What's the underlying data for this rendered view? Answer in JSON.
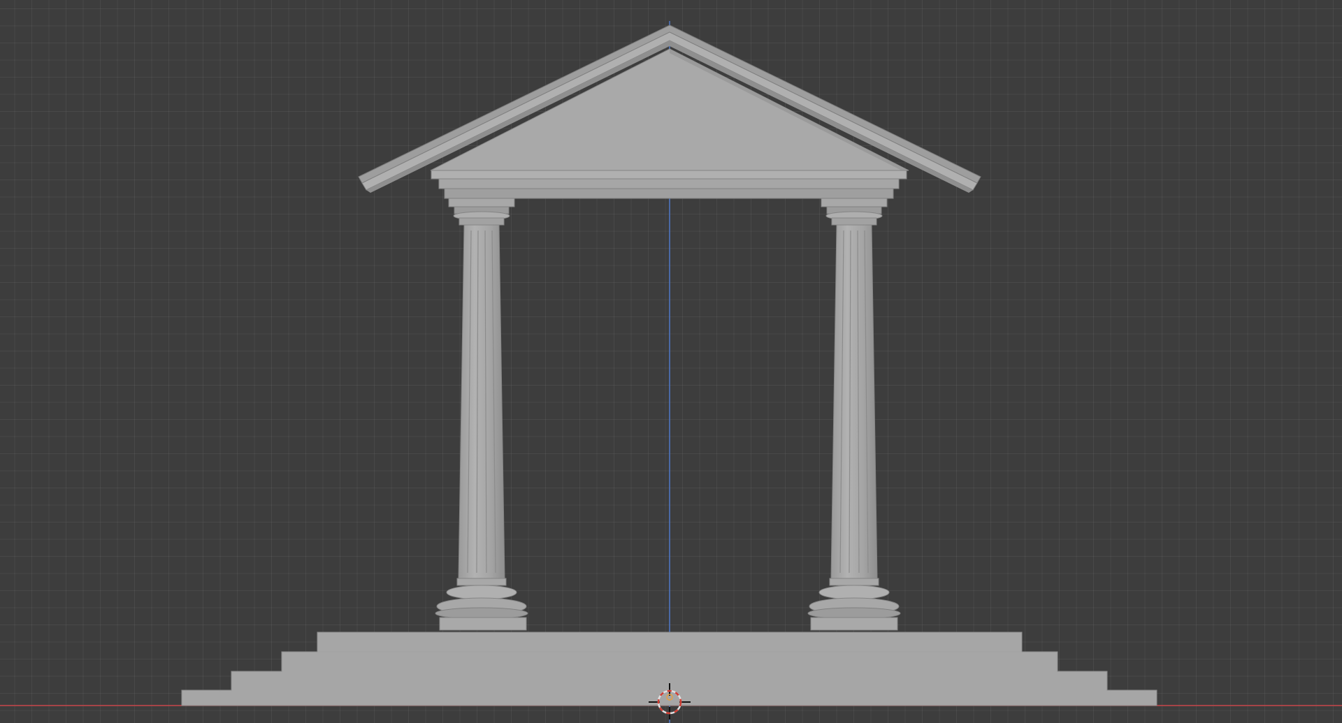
{
  "viewport": {
    "background_color": "#3d3d3d",
    "grid_color": "#4a4a4a",
    "x_axis_color": "#c8464b",
    "z_axis_color": "#4f78c8",
    "model_color": "#a8a8a8",
    "model_shadow_color": "#8a8a8a",
    "cursor_ring_colors": [
      "#e0e0e0",
      "#d23c32"
    ],
    "cursor_icon": "3d-cursor-icon"
  },
  "scene": {
    "objects": [
      "pediment",
      "architrave",
      "column-left",
      "column-right",
      "stepped-base"
    ]
  }
}
